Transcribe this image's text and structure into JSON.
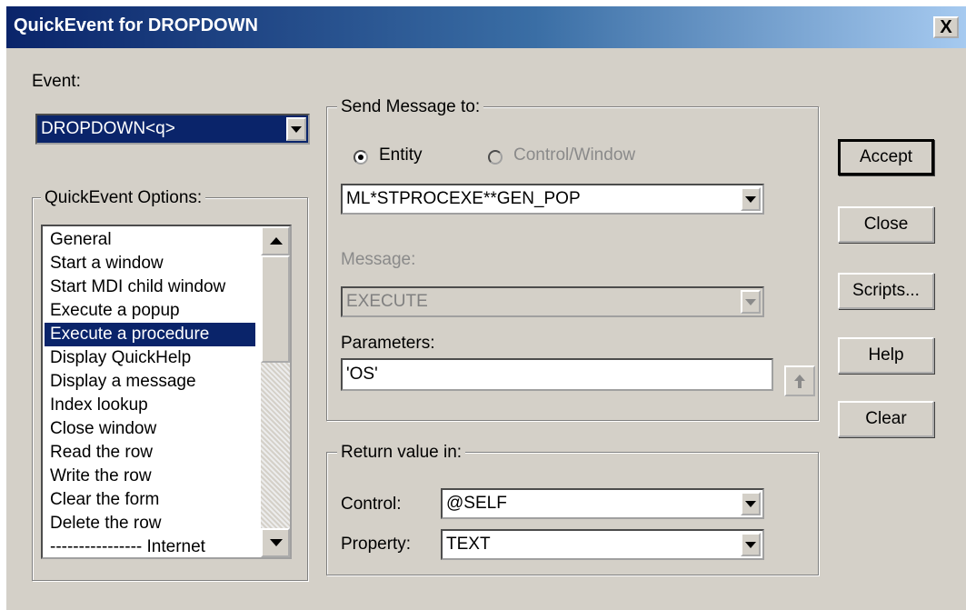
{
  "window": {
    "title": "QuickEvent for DROPDOWN",
    "close_label": "X"
  },
  "event": {
    "label": "Event:",
    "value": "DROPDOWN<q>"
  },
  "options": {
    "legend": "QuickEvent Options:",
    "items": [
      "General",
      "Start a window",
      "Start MDI child window",
      "Execute a popup",
      "Execute a procedure",
      "Display QuickHelp",
      "Display a message",
      "Index lookup",
      "Close window",
      "Read the row",
      "Write the row",
      "Clear the form",
      "Delete the row",
      "---------------- Internet"
    ],
    "selected": "Execute a procedure"
  },
  "send": {
    "legend": "Send Message to:",
    "radio_entity": "Entity",
    "radio_control": "Control/Window",
    "selected_radio": "Entity",
    "target": "ML*STPROCEXE**GEN_POP",
    "message_label": "Message:",
    "message_value": "EXECUTE",
    "params_label": "Parameters:",
    "params_value": "'OS'"
  },
  "return": {
    "legend": "Return value in:",
    "control_label": "Control:",
    "control_value": "@SELF",
    "property_label": "Property:",
    "property_value": "TEXT"
  },
  "buttons": {
    "accept": "Accept",
    "close": "Close",
    "scripts": "Scripts...",
    "help": "Help",
    "clear": "Clear"
  },
  "colors": {
    "titlebar": "#0a246a",
    "selection": "#0a246a",
    "face": "#d4d0c8"
  }
}
